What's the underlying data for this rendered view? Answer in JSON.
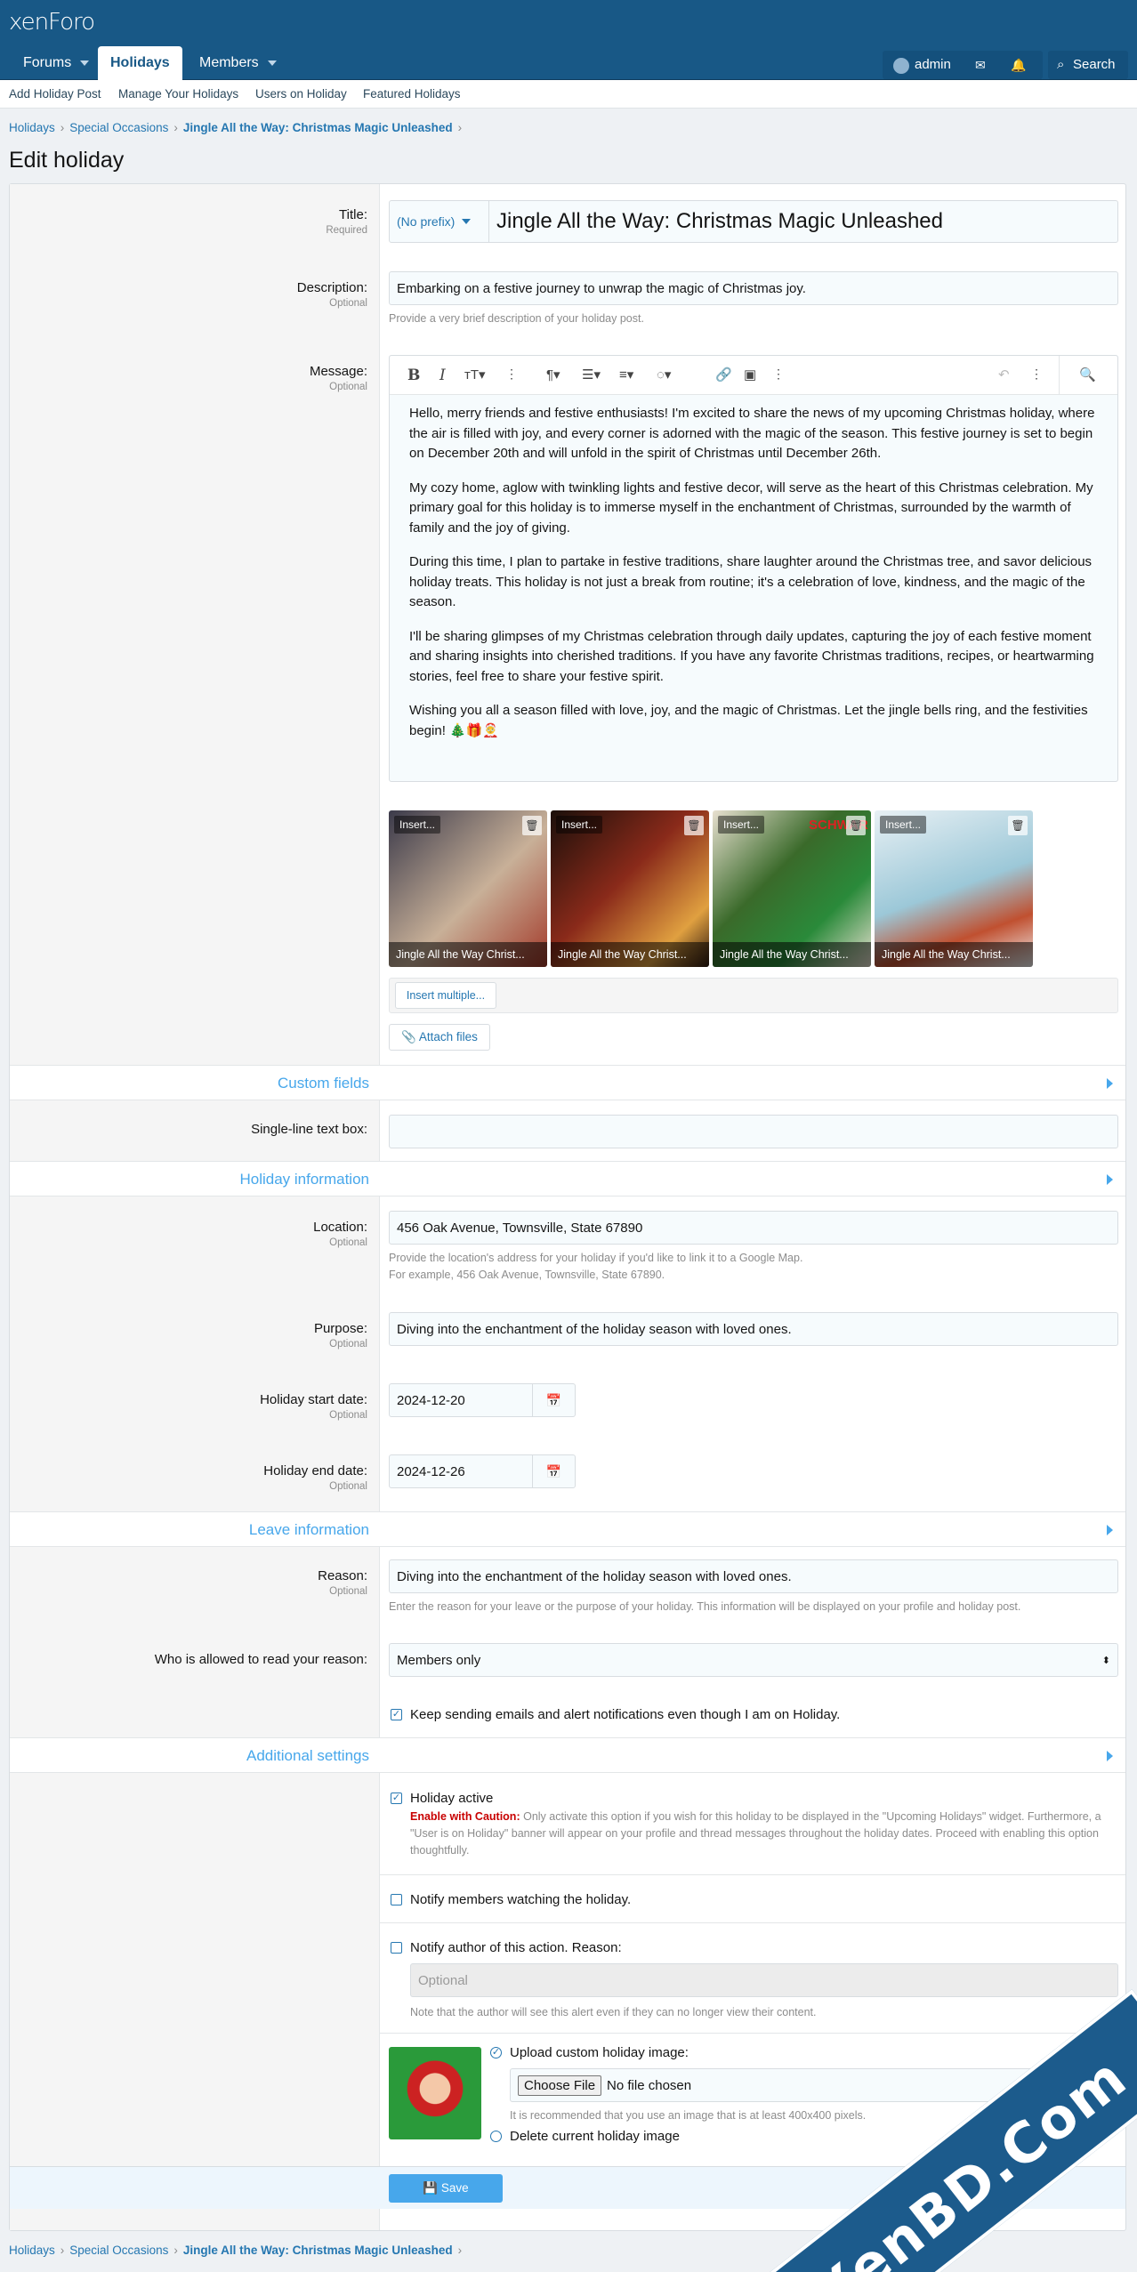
{
  "header": {
    "logo": "xenForo"
  },
  "nav": {
    "tabs": [
      {
        "label": "Forums"
      },
      {
        "label": "Holidays"
      },
      {
        "label": "Members"
      }
    ],
    "user": "admin",
    "search": "Search"
  },
  "subnav": [
    "Add Holiday Post",
    "Manage Your Holidays",
    "Users on Holiday",
    "Featured Holidays"
  ],
  "breadcrumb": {
    "items": [
      "Holidays",
      "Special Occasions"
    ],
    "current": "Jingle All the Way: Christmas Magic Unleashed"
  },
  "page": {
    "title": "Edit holiday"
  },
  "form": {
    "title": {
      "label": "Title:",
      "hint": "Required",
      "prefix": "(No prefix)",
      "value": "Jingle All the Way: Christmas Magic Unleashed"
    },
    "description": {
      "label": "Description:",
      "hint": "Optional",
      "value": "Embarking on a festive journey to unwrap the magic of Christmas joy.",
      "explain": "Provide a very brief description of your holiday post."
    },
    "message": {
      "label": "Message:",
      "hint": "Optional",
      "paragraphs": [
        "Hello, merry friends and festive enthusiasts! I'm excited to share the news of my upcoming Christmas holiday, where the air is filled with joy, and every corner is adorned with the magic of the season. This festive journey is set to begin on December 20th and will unfold in the spirit of Christmas until December 26th.",
        "My cozy home, aglow with twinkling lights and festive decor, will serve as the heart of this Christmas celebration. My primary goal for this holiday is to immerse myself in the enchantment of Christmas, surrounded by the warmth of family and the joy of giving.",
        "During this time, I plan to partake in festive traditions, share laughter around the Christmas tree, and savor delicious holiday treats. This holiday is not just a break from routine; it's a celebration of love, kindness, and the magic of the season.",
        "I'll be sharing glimpses of my Christmas celebration through daily updates, capturing the joy of each festive moment and sharing insights into cherished traditions. If you have any favorite Christmas traditions, recipes, or heartwarming stories, feel free to share your festive spirit.",
        "Wishing you all a season filled with love, joy, and the magic of Christmas. Let the jingle bells ring, and the festivities begin! 🎄🎁🤶"
      ]
    },
    "attachments": {
      "insert": "Insert...",
      "caption": "Jingle All the Way Christ...",
      "insert_multiple": "Insert multiple...",
      "attach": "Attach files",
      "overlay_text": "SCHWAR"
    },
    "custom_fields": {
      "heading": "Custom fields",
      "single_line_label": "Single-line text box:"
    },
    "holiday_info": {
      "heading": "Holiday information",
      "location": {
        "label": "Location:",
        "hint": "Optional",
        "value": "456 Oak Avenue, Townsville, State 67890",
        "explain1": "Provide the location's address for your holiday if you'd like to link it to a Google Map.",
        "explain2": "For example, 456 Oak Avenue, Townsville, State 67890."
      },
      "purpose": {
        "label": "Purpose:",
        "hint": "Optional",
        "value": "Diving into the enchantment of the holiday season with loved ones."
      },
      "start": {
        "label": "Holiday start date:",
        "hint": "Optional",
        "value": "2024-12-20"
      },
      "end": {
        "label": "Holiday end date:",
        "hint": "Optional",
        "value": "2024-12-26"
      }
    },
    "leave_info": {
      "heading": "Leave information",
      "reason": {
        "label": "Reason:",
        "hint": "Optional",
        "value": "Diving into the enchantment of the holiday season with loved ones.",
        "explain": "Enter the reason for your leave or the purpose of your holiday. This information will be displayed on your profile and holiday post."
      },
      "who": {
        "label": "Who is allowed to read your reason:",
        "value": "Members only"
      },
      "keep_sending": "Keep sending emails and alert notifications even though I am on Holiday."
    },
    "additional": {
      "heading": "Additional settings",
      "active": "Holiday active",
      "caution_label": "Enable with Caution:",
      "caution_text": "Only activate this option if you wish for this holiday to be displayed in the \"Upcoming Holidays\" widget. Furthermore, a \"User is on Holiday\" banner will appear on your profile and thread messages throughout the holiday dates. Proceed with enabling this option thoughtfully.",
      "notify_watchers": "Notify members watching the holiday.",
      "notify_author": "Notify author of this action. Reason:",
      "reason_placeholder": "Optional",
      "author_note": "Note that the author will see this alert even if they can no longer view their content.",
      "upload": "Upload custom holiday image:",
      "choose_file": "Choose File",
      "no_file": "No file chosen",
      "upload_hint": "It is recommended that you use an image that is at least 400x400 pixels.",
      "delete": "Delete current holiday image"
    },
    "save": "Save"
  },
  "watermark": "XenBD.Com"
}
